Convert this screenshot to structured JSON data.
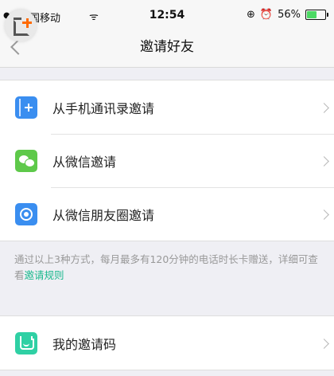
{
  "status_bar": {
    "carrier": "中国移动",
    "time": "12:54",
    "battery": "56%",
    "battery_level": 0.56
  },
  "nav": {
    "title": "邀请好友"
  },
  "invite_options": [
    {
      "label": "从手机通讯录邀请",
      "icon": "contacts-icon"
    },
    {
      "label": "从微信邀请",
      "icon": "wechat-icon"
    },
    {
      "label": "从微信朋友圈邀请",
      "icon": "moments-icon"
    }
  ],
  "note": {
    "text": "通过以上3种方式，每月最多有120分钟的电话时长卡赠送，详细可查看",
    "link": "邀请规则"
  },
  "my_code": {
    "label": "我的邀请码",
    "icon": "invite-code-icon"
  },
  "colors": {
    "accent_link": "#18b88c",
    "wechat_green": "#5ec94a",
    "blue": "#3a8ef0",
    "teal": "#2fd0a4"
  }
}
